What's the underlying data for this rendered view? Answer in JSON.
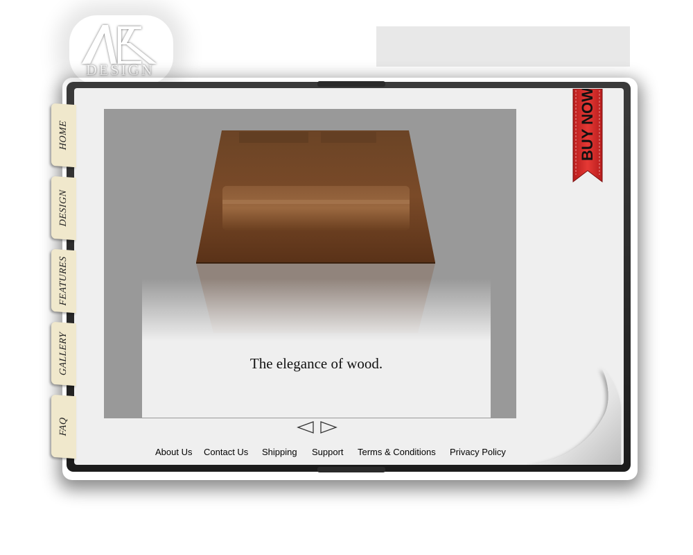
{
  "logo": {
    "mark": "AEK",
    "word": "DESIGN"
  },
  "nav_tabs": [
    "HOME",
    "DESIGN",
    "FEATURES",
    "GALLERY",
    "FAQ"
  ],
  "slideshow": {
    "caption": "The elegance of wood."
  },
  "buy_now": {
    "label": "BUY NOW"
  },
  "footer_links": [
    "About Us",
    "Contact Us",
    "Shipping",
    "Support",
    "Terms & Conditions",
    "Privacy Policy"
  ],
  "colors": {
    "tab": "#f0e8cc",
    "page": "#efefef",
    "ribbon": "#d32f2f",
    "slide_bg": "#999999"
  }
}
